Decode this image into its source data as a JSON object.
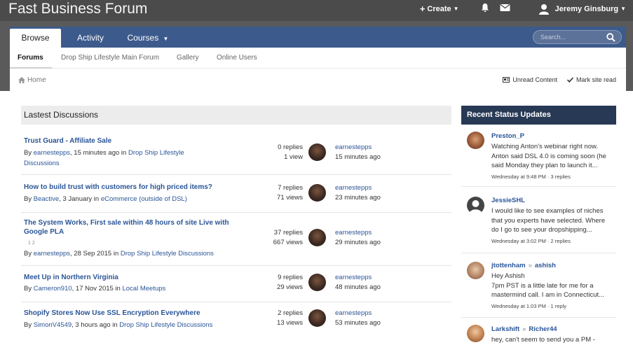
{
  "header": {
    "site_title": "Fast Business Forum",
    "create_label": "Create",
    "user_name": "Jeremy Ginsburg"
  },
  "nav": {
    "tabs": [
      {
        "label": "Browse",
        "active": true
      },
      {
        "label": "Activity",
        "active": false
      },
      {
        "label": "Courses",
        "active": false
      }
    ],
    "search_placeholder": "Search..."
  },
  "subnav": {
    "items": [
      "Forums",
      "Drop Ship Lifestyle Main Forum",
      "Gallery",
      "Online Users"
    ]
  },
  "breadcrumb": {
    "home": "Home",
    "unread": "Unread Content",
    "mark_read": "Mark site read"
  },
  "discussions": {
    "heading": "Lastest Discussions",
    "topics": [
      {
        "title": "Trust Guard - Affiliate Sale",
        "title2": "",
        "by": "By ",
        "author": "earnestepps",
        "when": ", 15 minutes ago in ",
        "forum": "Drop Ship Lifestyle",
        "forum2": "Discussions",
        "replies": "0 replies",
        "views": "1 view",
        "last_user": "earnestepps",
        "last_time": "15 minutes ago"
      },
      {
        "title": "How to build trust with customers for high priced items?",
        "title2": "",
        "by": "By ",
        "author": "Beactive",
        "when": ", 3 January in ",
        "forum": "eCommerce (outside of DSL)",
        "forum2": "",
        "replies": "7 replies",
        "views": "71 views",
        "last_user": "earnestepps",
        "last_time": "23 minutes ago"
      },
      {
        "title": "The System Works, First sale within 48 hours of site Live with",
        "title2": "Google PLA",
        "pages": "1   2",
        "by": "By ",
        "author": "earnestepps",
        "when": ", 28 Sep 2015 in ",
        "forum": "Drop Ship Lifestyle Discussions",
        "forum2": "",
        "replies": "37 replies",
        "views": "667 views",
        "last_user": "earnestepps",
        "last_time": "29 minutes ago"
      },
      {
        "title": "Meet Up in Northern Virginia",
        "title2": "",
        "by": "By ",
        "author": "Cameron910",
        "when": ", 17 Nov 2015 in ",
        "forum": "Local Meetups",
        "forum2": "",
        "replies": "9 replies",
        "views": "29 views",
        "last_user": "earnestepps",
        "last_time": "48 minutes ago"
      },
      {
        "title": "Shopify Stores Now Use SSL Encryption Everywhere",
        "title2": "",
        "by": "By ",
        "author": "SimonV4549",
        "when": ", 3 hours ago in ",
        "forum": "Drop Ship Lifestyle Discussions",
        "forum2": "",
        "replies": "2 replies",
        "views": "13 views",
        "last_user": "earnestepps",
        "last_time": "53 minutes ago"
      }
    ]
  },
  "status_updates": {
    "heading": "Recent Status Updates",
    "items": [
      {
        "name": "Preston_P",
        "to": "",
        "lines": [
          "Watching Anton's webinar right now.",
          "Anton said DSL 4.0 is coming soon (he",
          "said Monday they plan to launch it..."
        ],
        "meta": "Wednesday at 9:48 PM · 3 replies"
      },
      {
        "name": "JessieSHL",
        "to": "",
        "lines": [
          "I would like to see examples of niches",
          "that you experts have selected. Where",
          "do I go to see your dropshipping..."
        ],
        "meta": "Wednesday at 3:02 PM · 2 replies"
      },
      {
        "name": "jtottenham",
        "to": "ashish",
        "lines": [
          "Hey Ashish",
          "7pm PST is a little late for me for a",
          "mastermind call. I am in Connecticut..."
        ],
        "meta": "Wednesday at 1:03 PM · 1 reply"
      },
      {
        "name": "Larkshift",
        "to": "Richer44",
        "lines": [
          "hey, can't seem to send you a PM -"
        ],
        "meta": ""
      }
    ]
  },
  "colors": {
    "header_bg": "#4b4b4b",
    "nav_bg": "#3c5a8b",
    "link": "#2a5597",
    "status_head_bg": "#283955"
  }
}
